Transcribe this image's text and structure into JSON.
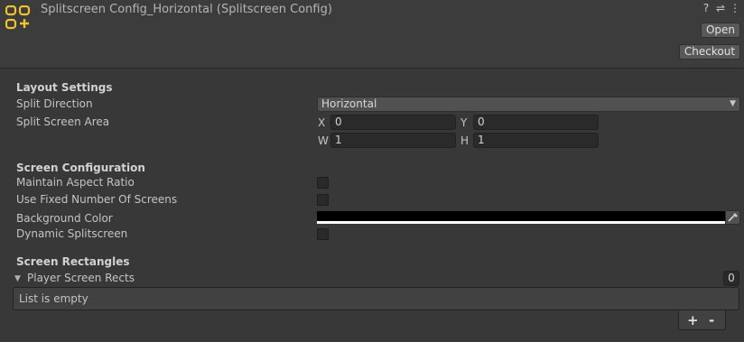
{
  "header": {
    "title": "Splitscreen Config_Horizontal (Splitscreen Config)",
    "icons": [
      "help-icon",
      "presets-icon",
      "more-icon"
    ],
    "icon_glyphs": {
      "help": "?",
      "presets": "⇌",
      "more": "⋮"
    },
    "open_label": "Open",
    "checkout_label": "Checkout"
  },
  "layout": {
    "section_title": "Layout Settings",
    "split_direction_label": "Split Direction",
    "split_direction_value": "Horizontal",
    "split_area_label": "Split Screen Area",
    "x_label": "X",
    "x_value": "0",
    "y_label": "Y",
    "y_value": "0",
    "w_label": "W",
    "w_value": "1",
    "h_label": "H",
    "h_value": "1"
  },
  "screen_config": {
    "section_title": "Screen Configuration",
    "maintain_aspect_label": "Maintain Aspect Ratio",
    "maintain_aspect_checked": false,
    "fixed_number_label": "Use Fixed Number Of Screens",
    "fixed_number_checked": false,
    "background_color_label": "Background Color",
    "background_color": "#000000",
    "dynamic_label": "Dynamic Splitscreen",
    "dynamic_checked": false
  },
  "screen_rects": {
    "section_title": "Screen Rectangles",
    "list_label": "Player Screen Rects",
    "count": "0",
    "empty_text": "List is empty",
    "add_label": "+",
    "remove_label": "-"
  },
  "colors": {
    "background": "#383838",
    "header": "#3c3c3c",
    "asset_icon": "#f2c12e"
  }
}
